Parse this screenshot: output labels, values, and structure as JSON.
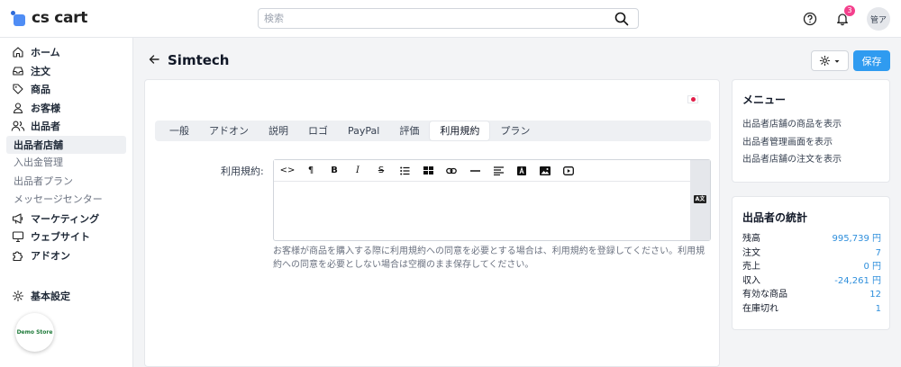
{
  "app": {
    "logo_text": "cs cart"
  },
  "search": {
    "placeholder": "検索"
  },
  "header": {
    "notification_count": "3",
    "user_initials": "管ア"
  },
  "sidebar": {
    "items": [
      {
        "label": "ホーム",
        "icon": "home-icon"
      },
      {
        "label": "注文",
        "icon": "inbox-icon"
      },
      {
        "label": "商品",
        "icon": "tag-icon"
      },
      {
        "label": "お客様",
        "icon": "user-icon"
      },
      {
        "label": "出品者",
        "icon": "users-icon"
      }
    ],
    "active_item": "出品者店舗",
    "sub_items": [
      "入出金管理",
      "出品者プラン",
      "メッセージセンター"
    ],
    "items_after": [
      {
        "label": "マーケティング",
        "icon": "megaphone-icon"
      },
      {
        "label": "ウェブサイト",
        "icon": "monitor-icon"
      },
      {
        "label": "アドオン",
        "icon": "puzzle-icon"
      }
    ],
    "settings_label": "基本設定",
    "demo_store_label": "Demo Store"
  },
  "page": {
    "title": "Simtech",
    "save_label": "保存"
  },
  "tabs": [
    "一般",
    "アドオン",
    "説明",
    "ロゴ",
    "PayPal",
    "評価",
    "利用規約",
    "プラン"
  ],
  "active_tab_index": 6,
  "form": {
    "field_label": "利用規約:",
    "editor_value": "",
    "help_text": "お客様が商品を購入する際に利用規約への同意を必要とする場合は、利用規約を登録してください。利用規約への同意を必要としない場合は空欄のまま保存してください。"
  },
  "menu_panel": {
    "title": "メニュー",
    "links": [
      "出品者店舗の商品を表示",
      "出品者管理画面を表示",
      "出品者店舗の注文を表示"
    ]
  },
  "stats_panel": {
    "title": "出品者の統計",
    "rows": [
      {
        "label": "残高",
        "value": "995,739 円"
      },
      {
        "label": "注文",
        "value": "7"
      },
      {
        "label": "売上",
        "value": "0 円"
      },
      {
        "label": "収入",
        "value": "-24,261 円"
      },
      {
        "label": "有効な商品",
        "value": "12"
      },
      {
        "label": "在庫切れ",
        "value": "1"
      }
    ]
  },
  "colors": {
    "accent": "#2f9bf0",
    "badge": "#f43f8c",
    "stat_value": "#2f8fdc"
  }
}
